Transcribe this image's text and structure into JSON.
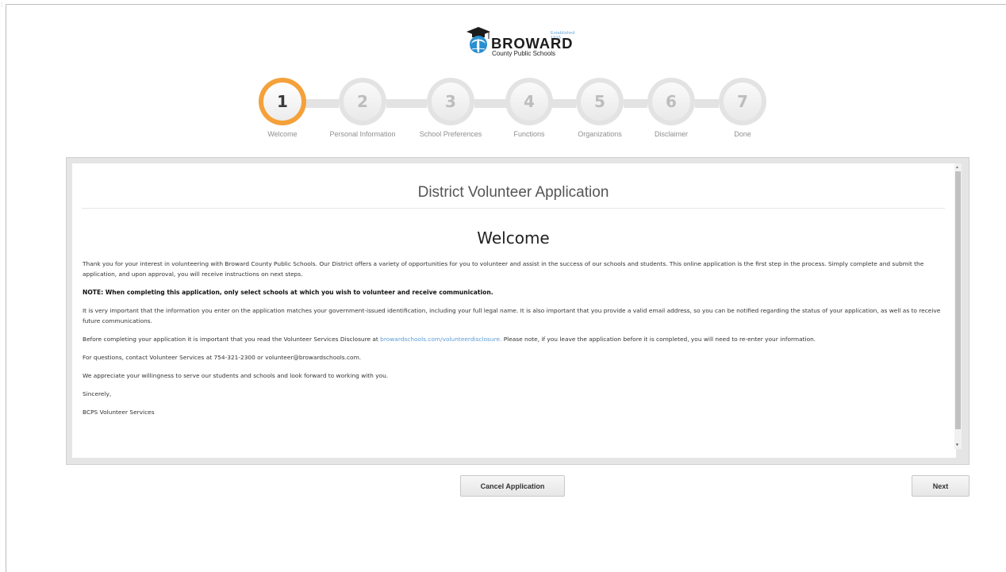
{
  "brand": {
    "established": "Established 1915",
    "name": "BROWARD",
    "subtitle": "County Public Schools"
  },
  "steps": [
    {
      "number": "1",
      "label": "Welcome",
      "active": true
    },
    {
      "number": "2",
      "label": "Personal Information",
      "active": false
    },
    {
      "number": "3",
      "label": "School Preferences",
      "active": false
    },
    {
      "number": "4",
      "label": "Functions",
      "active": false
    },
    {
      "number": "5",
      "label": "Organizations",
      "active": false
    },
    {
      "number": "6",
      "label": "Disclaimer",
      "active": false
    },
    {
      "number": "7",
      "label": "Done",
      "active": false
    }
  ],
  "content": {
    "app_title": "District Volunteer Application",
    "heading": "Welcome",
    "p1": "Thank you for your interest in volunteering with Broward County Public Schools. Our District offers a variety of opportunities for you to volunteer and assist in the success of our schools and students. This online application is the first step in the process. Simply complete and submit the application, and upon approval, you will receive instructions on next steps.",
    "note": "NOTE: When completing this application, only select schools at which you wish to volunteer and receive communication.",
    "p2": "It is very important that the information you enter on the application matches your government-issued identification, including your full legal name. It is also important that you provide a valid email address, so you can be notified regarding the status of your application, as well as to receive future communications.",
    "p3_before": "Before completing your application it is important that you read the Volunteer Services Disclosure at ",
    "p3_link": "browardschools.com/volunteerdisclosure.",
    "p3_after": " Please note, if you leave the application before it is completed, you will need to re-enter your information.",
    "p4": "For questions, contact Volunteer Services at 754-321-2300 or volunteer@browardschools.com.",
    "p5": "We appreciate your willingness to serve our students and schools and look forward to working with you.",
    "p6": "Sincerely,",
    "p7": "BCPS Volunteer Services"
  },
  "buttons": {
    "cancel": "Cancel Application",
    "next": "Next"
  },
  "colors": {
    "active_step": "#f4a13a",
    "link": "#5b9bd5",
    "brand_blue": "#2a8fd0"
  }
}
